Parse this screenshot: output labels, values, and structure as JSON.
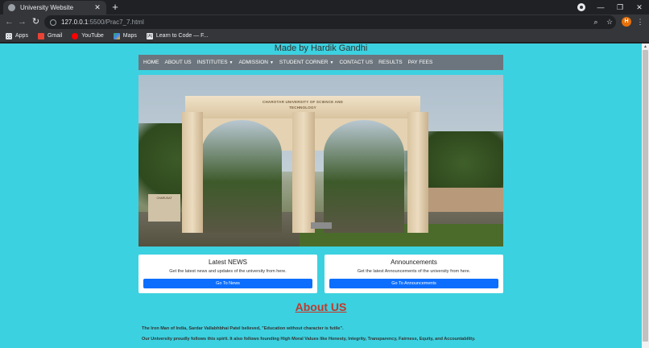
{
  "browser": {
    "tab_title": "University Website",
    "tab_close": "✕",
    "new_tab": "+",
    "url_host": "127.0.0.1",
    "url_rest": ":5500/Prac7_7.html",
    "avatar_initial": "H",
    "window_controls": [
      "—",
      "❐",
      "✕"
    ],
    "bookmarks": [
      {
        "label": "Apps",
        "icon": "apps-icon"
      },
      {
        "label": "Gmail",
        "icon": "gmail-icon"
      },
      {
        "label": "YouTube",
        "icon": "youtube-icon"
      },
      {
        "label": "Maps",
        "icon": "maps-icon"
      },
      {
        "label": "Learn to Code — F...",
        "icon": "freecodecamp-icon"
      }
    ]
  },
  "page": {
    "made_by": "Made by Hardik Gandhi",
    "nav": [
      {
        "label": "HOME",
        "dropdown": false
      },
      {
        "label": "ABOUT US",
        "dropdown": false
      },
      {
        "label": "INSTITUTES",
        "dropdown": true
      },
      {
        "label": "ADMISSION",
        "dropdown": true
      },
      {
        "label": "STUDENT CORNER",
        "dropdown": true
      },
      {
        "label": "CONTACT US",
        "dropdown": false
      },
      {
        "label": "RESULTS",
        "dropdown": false
      },
      {
        "label": "PAY FEES",
        "dropdown": false
      }
    ],
    "hero": {
      "arch_sign": "CHAROTAR UNIVERSITY OF SCIENCE AND TECHNOLOGY",
      "plaque_text": "CHARUSAT"
    },
    "cards": [
      {
        "title": "Latest NEWS",
        "text": "Get the latest news and updates of the university from here.",
        "button": "Go To News"
      },
      {
        "title": "Announcements",
        "text": "Get the latest Announcements of the university from here.",
        "button": "Go To Announcements"
      }
    ],
    "about": {
      "heading": "About US",
      "p1": "The Iron Man of India, Sardar Vallabhbhai Patel believed, \"Education without character is futile\".",
      "p2": "Our University proudly follows this spirit. It also follows founding High Moral Values like Honesty, Integrity, Transparency, Fairness, Equity, and Accountability."
    },
    "colors": {
      "background": "#3cd1e0",
      "nav": "#6c757d",
      "button": "#0d6efd",
      "about_heading": "#c0392b"
    }
  }
}
